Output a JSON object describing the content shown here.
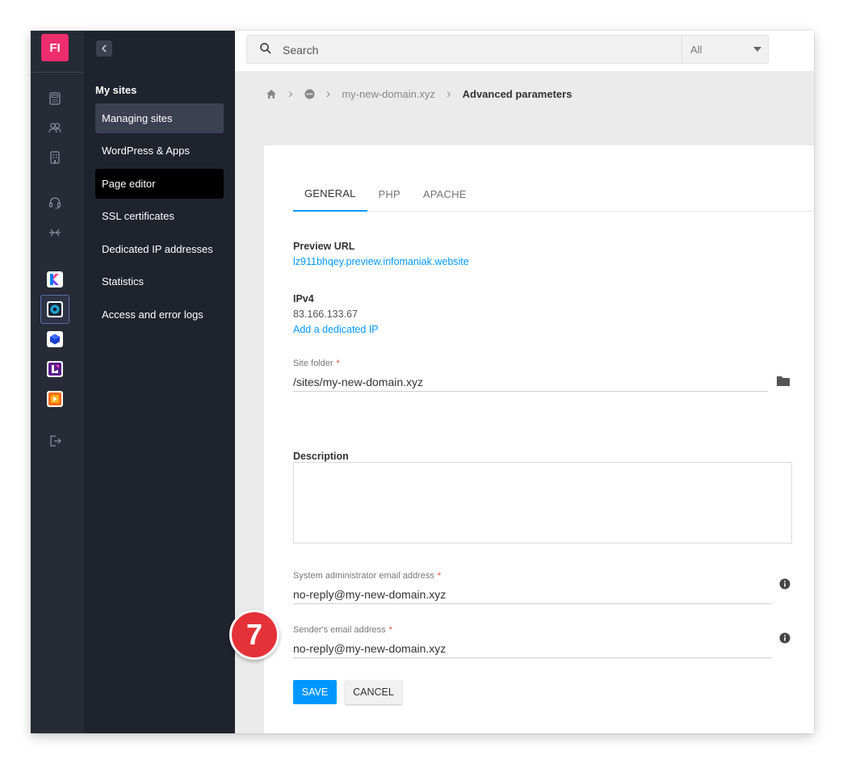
{
  "app": {
    "logo_text": "FI",
    "accent": "#0098ff",
    "logo_color": "#ee2d6d"
  },
  "rail": {
    "icons": [
      "calculator-icon",
      "users-icon",
      "building-icon",
      "headset-icon",
      "network-icon"
    ],
    "apps": [
      "kdrive-app-icon",
      "web-hosting-app-icon",
      "cube-app-icon",
      "kmeet-app-icon",
      "streaming-app-icon"
    ],
    "logout_icon": "logout-icon"
  },
  "menu": {
    "title": "My sites",
    "items": [
      {
        "label": "Managing sites"
      },
      {
        "label": "WordPress & Apps"
      },
      {
        "label": "Page editor"
      },
      {
        "label": "SSL certificates"
      },
      {
        "label": "Dedicated IP addresses"
      },
      {
        "label": "Statistics"
      },
      {
        "label": "Access and error logs"
      }
    ]
  },
  "search": {
    "placeholder": "Search",
    "scope": "All"
  },
  "breadcrumb": {
    "domain": "my-new-domain.xyz",
    "current": "Advanced parameters"
  },
  "tabs": [
    {
      "label": "GENERAL"
    },
    {
      "label": "PHP"
    },
    {
      "label": "APACHE"
    }
  ],
  "form": {
    "preview_url_label": "Preview URL",
    "preview_url": "lz911bhqey.preview.infomaniak.website",
    "ipv4_label": "IPv4",
    "ipv4_value": "83.166.133.67",
    "add_ip_link": "Add a dedicated IP",
    "site_folder_label": "Site folder",
    "site_folder_value": "/sites/my-new-domain.xyz",
    "required_mark": "*",
    "description_label": "Description",
    "description_value": "",
    "admin_email_label": "System administrator email address",
    "admin_email_value": "no-reply@my-new-domain.xyz",
    "sender_email_label": "Sender's email address",
    "sender_email_value": "no-reply@my-new-domain.xyz",
    "save_label": "SAVE",
    "cancel_label": "CANCEL"
  },
  "step_badge": "7"
}
